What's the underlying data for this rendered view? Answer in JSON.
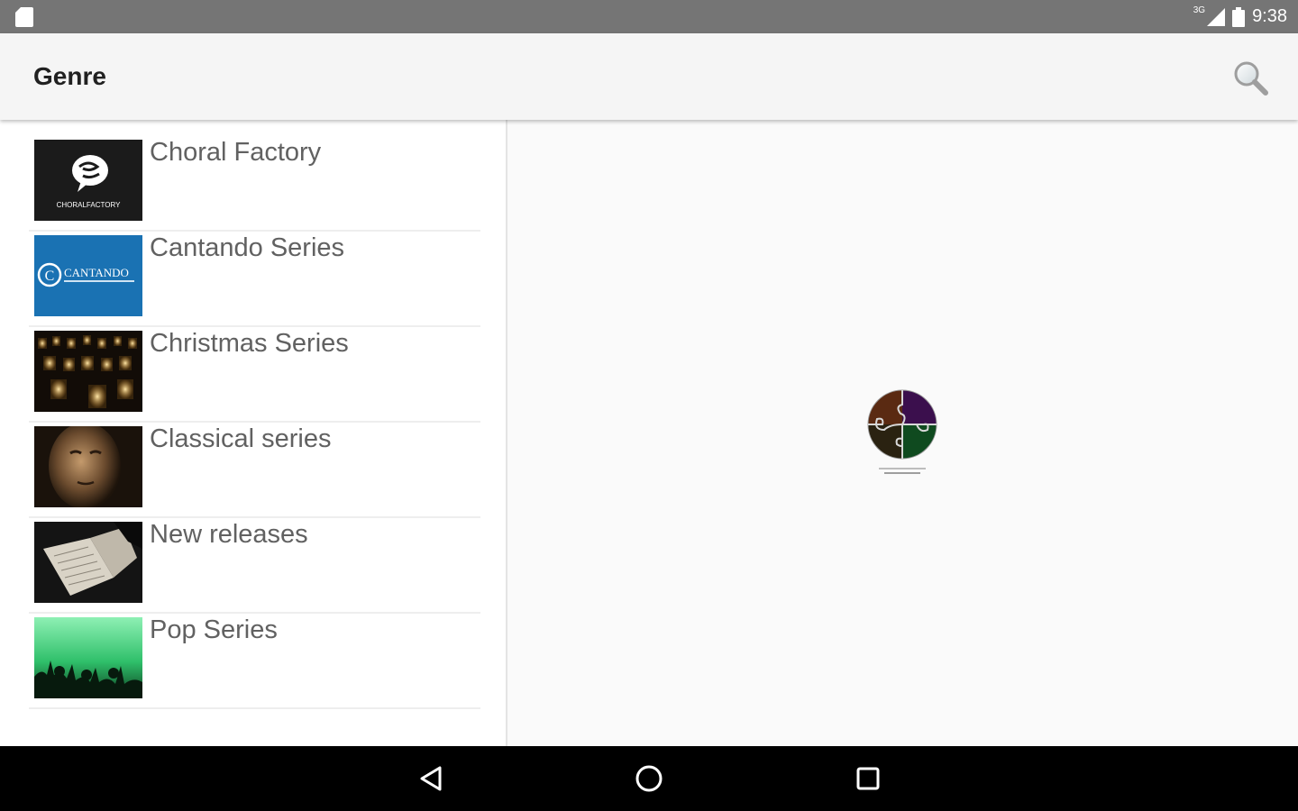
{
  "status_bar": {
    "network_badge": "3G",
    "time": "9:38",
    "icons": [
      "sd-card-icon",
      "signal-icon",
      "battery-icon"
    ]
  },
  "app_bar": {
    "title": "Genre",
    "search_icon": "search-icon"
  },
  "genres": [
    {
      "label": "Choral Factory",
      "thumb_text": "CHORALFACTORY"
    },
    {
      "label": "Cantando Series",
      "thumb_text": "CANTANDO"
    },
    {
      "label": "Christmas Series"
    },
    {
      "label": "Classical series"
    },
    {
      "label": "New releases"
    },
    {
      "label": "Pop Series"
    }
  ],
  "nav_bar": {
    "icons": [
      "back-icon",
      "home-icon",
      "recents-icon"
    ]
  },
  "colors": {
    "status_bar": "#757575",
    "app_bar": "#f5f5f5",
    "nav_bar": "#000000",
    "label_text": "#616161",
    "cantando_blue": "#1a72b3"
  }
}
